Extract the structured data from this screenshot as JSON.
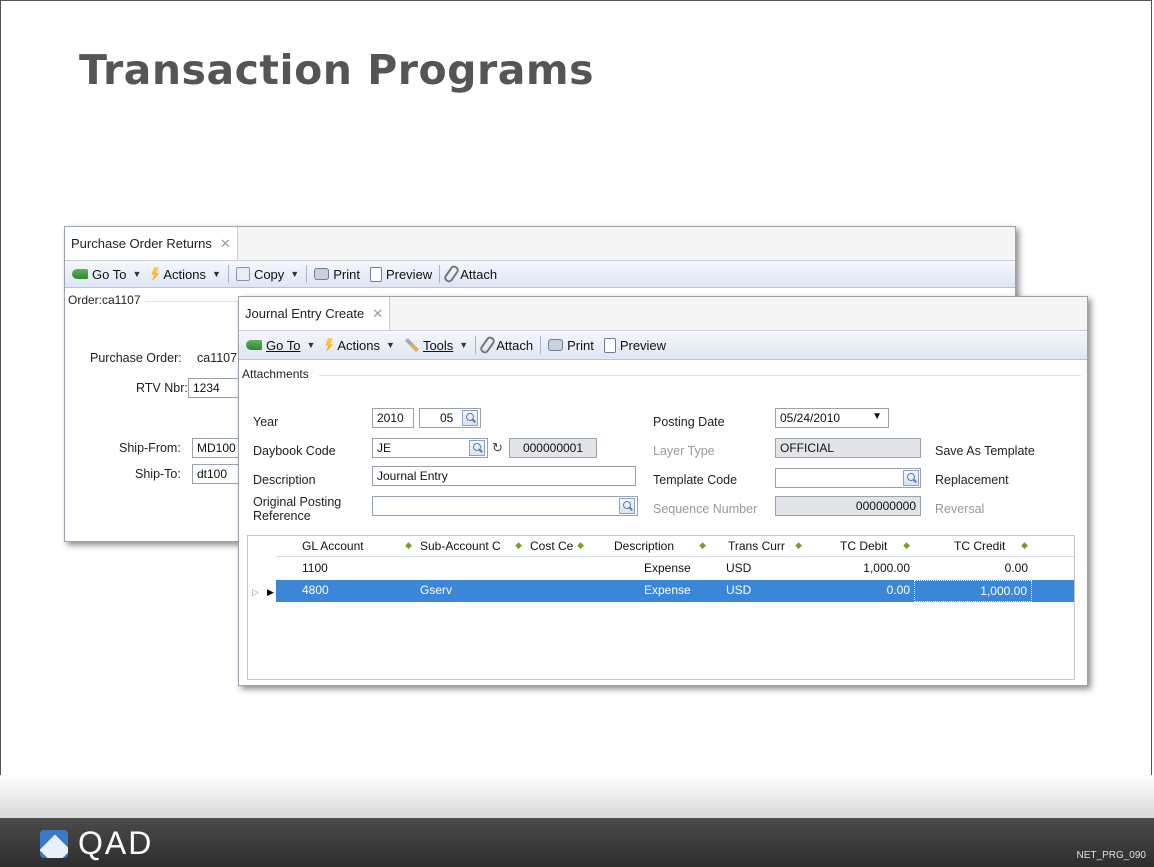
{
  "slide": {
    "title": "Transaction Programs",
    "footer_logo_text": "QAD",
    "slide_id": "NET_PRG_090"
  },
  "back_window": {
    "tab_label": "Purchase Order Returns",
    "toolbar": {
      "goto": "Go To",
      "actions": "Actions",
      "copy": "Copy",
      "print": "Print",
      "preview": "Preview",
      "attach": "Attach"
    },
    "group_label": "Order:ca1107",
    "fields": {
      "purchase_order_label": "Purchase Order:",
      "purchase_order_value": "ca1107",
      "rtv_label": "RTV Nbr:",
      "rtv_value": "1234",
      "ship_from_label": "Ship-From:",
      "ship_from_value": "MD100",
      "ship_to_label": "Ship-To:",
      "ship_to_value": "dt100"
    }
  },
  "front_window": {
    "tab_label": "Journal Entry Create",
    "toolbar": {
      "goto": "Go To",
      "actions": "Actions",
      "tools": "Tools",
      "attach": "Attach",
      "print": "Print",
      "preview": "Preview"
    },
    "group_label": "Attachments",
    "fields": {
      "year_label": "Year",
      "year_value": "2010",
      "period_value": "05",
      "daybook_label": "Daybook Code",
      "daybook_value": "JE",
      "daybook_number": "000000001",
      "description_label": "Description",
      "description_value": "Journal Entry",
      "orig_ref_label": "Original Posting Reference",
      "orig_ref_value": "",
      "posting_date_label": "Posting Date",
      "posting_date_value": "05/24/2010",
      "layer_type_label": "Layer Type",
      "layer_type_value": "OFFICIAL",
      "template_code_label": "Template Code",
      "template_code_value": "",
      "sequence_label": "Sequence Number",
      "sequence_value": "000000000",
      "save_as_template": "Save As Template",
      "replacement": "Replacement",
      "reversal": "Reversal"
    },
    "grid": {
      "columns": [
        "GL Account",
        "Sub-Account C",
        "Cost Ce",
        "Description",
        "Trans Curr",
        "TC Debit",
        "TC Credit"
      ],
      "rows": [
        {
          "gl_account": "1100",
          "sub_account": "",
          "cost_center": "",
          "description": "Expense",
          "currency": "USD",
          "debit": "1,000.00",
          "credit": "0.00"
        },
        {
          "gl_account": "4800",
          "sub_account": "Gserv",
          "cost_center": "",
          "description": "Expense",
          "currency": "USD",
          "debit": "0.00",
          "credit": "1,000.00"
        }
      ]
    }
  },
  "colors": {
    "title": "#555555",
    "selection": "#3b86d6",
    "footer": "#3a3a3a",
    "toolbar": "#dfe6f2"
  }
}
